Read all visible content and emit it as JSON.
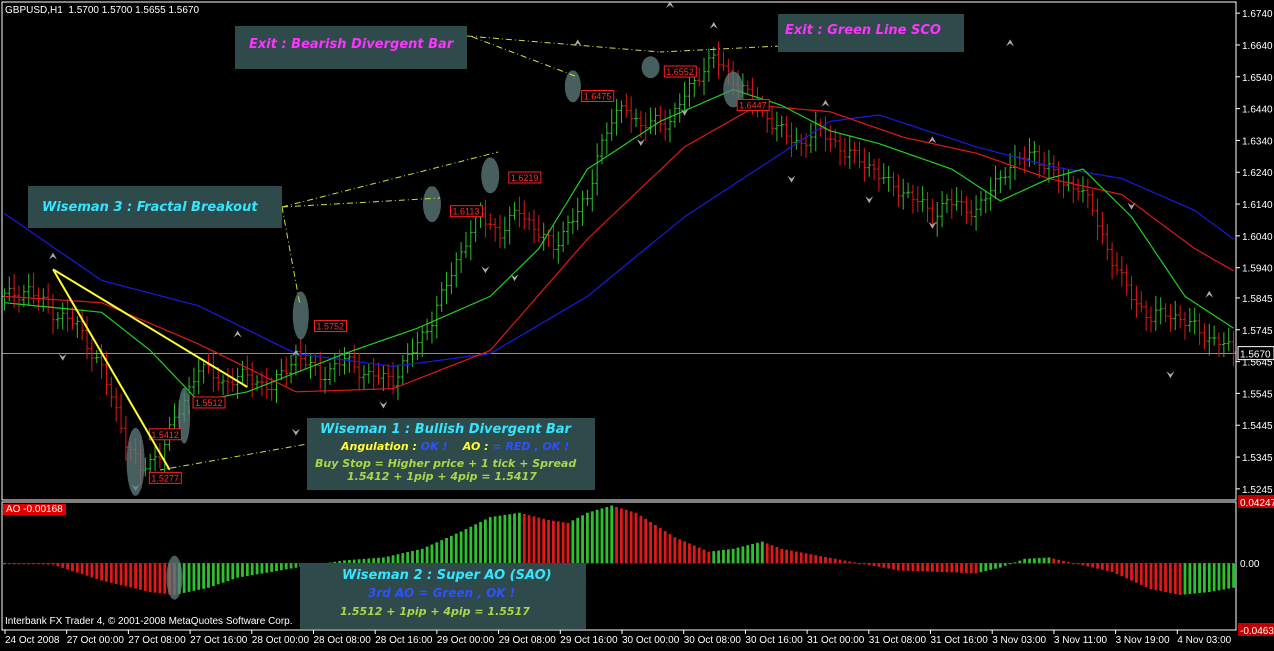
{
  "header": {
    "symbol": "GBPUSD,H1",
    "ohlc": "1.5700 1.5700 1.5655 1.5670"
  },
  "ao_panel": {
    "label": "AO -0.00168",
    "copyright": "Interbank FX Trader 4, © 2001-2008 MetaQuotes Software Corp."
  },
  "notes": {
    "exit1": "Exit : Bearish Divergent Bar",
    "exit2": "Exit : Green Line SCO",
    "wiseman3": "Wiseman 3 : Fractal Breakout",
    "wiseman1": {
      "title": "Wiseman 1 : Bullish Divergent Bar",
      "angulation": "Angulation :",
      "ok1": "OK !",
      "ao": "AO :",
      "red": "= RED , OK !",
      "buystop": "Buy Stop =  Higher price + 1 tick + Spread",
      "calc": "1.5412 + 1pip + 4pip = 1.5417"
    },
    "wiseman2": {
      "title": "Wiseman 2 : Super AO (SAO)",
      "line2": "3rd AO = Green , OK !",
      "line3": "1.5512 + 1pip + 4pip = 1.5517"
    }
  },
  "colors": {
    "bull": "#2ec02e",
    "bear": "#e01818",
    "jaw": "#1a1ae0",
    "teeth": "#e01818",
    "lips": "#20d020",
    "note_bg": "#2e4a4a",
    "yellow": "#ffff33",
    "cyan": "#33e5ff",
    "magenta": "#ff33ff"
  },
  "chart_data": [
    {
      "type": "candlestick",
      "title": "GBPUSD,H1",
      "ylim": [
        1.521,
        1.6775
      ],
      "y_ticks": [
        "1.6740",
        "1.6640",
        "1.6540",
        "1.6440",
        "1.6340",
        "1.6240",
        "1.6140",
        "1.6040",
        "1.5940",
        "1.5845",
        "1.5745",
        "1.5645",
        "1.5545",
        "1.5445",
        "1.5345",
        "1.5245"
      ],
      "current_price": "1.5670",
      "x_ticks": [
        "24 Oct 2008",
        "27 Oct 00:00",
        "27 Oct 08:00",
        "27 Oct 16:00",
        "28 Oct 00:00",
        "28 Oct 08:00",
        "28 Oct 16:00",
        "29 Oct 00:00",
        "29 Oct 08:00",
        "29 Oct 16:00",
        "30 Oct 00:00",
        "30 Oct 08:00",
        "30 Oct 16:00",
        "31 Oct 00:00",
        "31 Oct 08:00",
        "31 Oct 16:00",
        "3 Nov 03:00",
        "3 Nov 11:00",
        "3 Nov 19:00",
        "4 Nov 03:00"
      ],
      "close_path": [
        [
          0,
          1.585
        ],
        [
          5,
          1.587
        ],
        [
          10,
          1.58
        ],
        [
          15,
          1.576
        ],
        [
          20,
          1.562
        ],
        [
          25,
          1.54
        ],
        [
          28,
          1.53
        ],
        [
          32,
          1.536
        ],
        [
          36,
          1.549
        ],
        [
          40,
          1.563
        ],
        [
          45,
          1.558
        ],
        [
          50,
          1.56
        ],
        [
          55,
          1.556
        ],
        [
          60,
          1.567
        ],
        [
          65,
          1.56
        ],
        [
          70,
          1.565
        ],
        [
          75,
          1.56
        ],
        [
          80,
          1.559
        ],
        [
          85,
          1.57
        ],
        [
          88,
          1.578
        ],
        [
          92,
          1.592
        ],
        [
          95,
          1.603
        ],
        [
          98,
          1.61
        ],
        [
          102,
          1.605
        ],
        [
          106,
          1.612
        ],
        [
          110,
          1.605
        ],
        [
          113,
          1.6
        ],
        [
          116,
          1.608
        ],
        [
          120,
          1.615
        ],
        [
          122,
          1.63
        ],
        [
          125,
          1.64
        ],
        [
          128,
          1.645
        ],
        [
          131,
          1.638
        ],
        [
          134,
          1.64
        ],
        [
          137,
          1.64
        ],
        [
          140,
          1.648
        ],
        [
          143,
          1.655
        ],
        [
          146,
          1.66
        ],
        [
          149,
          1.655
        ],
        [
          152,
          1.65
        ],
        [
          155,
          1.645
        ],
        [
          158,
          1.64
        ],
        [
          161,
          1.635
        ],
        [
          164,
          1.633
        ],
        [
          167,
          1.637
        ],
        [
          170,
          1.635
        ],
        [
          173,
          1.63
        ],
        [
          176,
          1.628
        ],
        [
          179,
          1.625
        ],
        [
          182,
          1.62
        ],
        [
          185,
          1.618
        ],
        [
          188,
          1.615
        ],
        [
          191,
          1.61
        ],
        [
          194,
          1.615
        ],
        [
          197,
          1.613
        ],
        [
          200,
          1.612
        ],
        [
          203,
          1.618
        ],
        [
          206,
          1.625
        ],
        [
          209,
          1.628
        ],
        [
          212,
          1.63
        ],
        [
          215,
          1.625
        ],
        [
          218,
          1.62
        ],
        [
          221,
          1.62
        ],
        [
          224,
          1.612
        ],
        [
          227,
          1.6
        ],
        [
          230,
          1.59
        ],
        [
          233,
          1.583
        ],
        [
          236,
          1.578
        ],
        [
          239,
          1.58
        ],
        [
          242,
          1.578
        ],
        [
          245,
          1.575
        ],
        [
          248,
          1.572
        ],
        [
          251,
          1.57
        ],
        [
          253,
          1.567
        ]
      ],
      "alligator": {
        "jaw": [
          [
            0,
            1.611
          ],
          [
            20,
            1.59
          ],
          [
            40,
            1.582
          ],
          [
            60,
            1.567
          ],
          [
            80,
            1.563
          ],
          [
            100,
            1.567
          ],
          [
            120,
            1.585
          ],
          [
            140,
            1.61
          ],
          [
            160,
            1.63
          ],
          [
            170,
            1.64
          ],
          [
            180,
            1.642
          ],
          [
            200,
            1.632
          ],
          [
            215,
            1.626
          ],
          [
            230,
            1.622
          ],
          [
            245,
            1.612
          ],
          [
            253,
            1.603
          ]
        ],
        "teeth": [
          [
            0,
            1.585
          ],
          [
            20,
            1.583
          ],
          [
            40,
            1.57
          ],
          [
            60,
            1.555
          ],
          [
            80,
            1.556
          ],
          [
            100,
            1.568
          ],
          [
            120,
            1.603
          ],
          [
            140,
            1.632
          ],
          [
            155,
            1.645
          ],
          [
            170,
            1.643
          ],
          [
            185,
            1.635
          ],
          [
            200,
            1.63
          ],
          [
            215,
            1.622
          ],
          [
            230,
            1.617
          ],
          [
            245,
            1.6
          ],
          [
            253,
            1.593
          ]
        ],
        "lips": [
          [
            0,
            1.583
          ],
          [
            20,
            1.58
          ],
          [
            30,
            1.568
          ],
          [
            40,
            1.552
          ],
          [
            50,
            1.555
          ],
          [
            70,
            1.567
          ],
          [
            85,
            1.575
          ],
          [
            100,
            1.585
          ],
          [
            110,
            1.6
          ],
          [
            120,
            1.625
          ],
          [
            135,
            1.64
          ],
          [
            150,
            1.65
          ],
          [
            160,
            1.645
          ],
          [
            170,
            1.637
          ],
          [
            180,
            1.633
          ],
          [
            195,
            1.625
          ],
          [
            205,
            1.615
          ],
          [
            215,
            1.622
          ],
          [
            222,
            1.625
          ],
          [
            232,
            1.61
          ],
          [
            243,
            1.585
          ],
          [
            253,
            1.575
          ]
        ]
      },
      "price_labels": [
        "1.5412",
        "1.5512",
        "1.5277",
        "1.5752",
        "1.6113",
        "1.6219",
        "1.6475",
        "1.6552",
        "1.6447"
      ]
    },
    {
      "type": "bar",
      "title": "AO -0.00168",
      "ylim": [
        -0.04631,
        0.04247
      ],
      "y_ticks": [
        "0.04247",
        "0.00",
        "-0.04631"
      ],
      "values_profile": [
        [
          0,
          0
        ],
        [
          10,
          -0.001
        ],
        [
          20,
          -0.012
        ],
        [
          30,
          -0.02
        ],
        [
          35,
          -0.022
        ],
        [
          42,
          -0.017
        ],
        [
          48,
          -0.01
        ],
        [
          55,
          -0.006
        ],
        [
          62,
          -0.002
        ],
        [
          70,
          0.002
        ],
        [
          78,
          0.004
        ],
        [
          86,
          0.01
        ],
        [
          94,
          0.022
        ],
        [
          100,
          0.032
        ],
        [
          106,
          0.035
        ],
        [
          112,
          0.03
        ],
        [
          116,
          0.028
        ],
        [
          120,
          0.035
        ],
        [
          125,
          0.04
        ],
        [
          130,
          0.035
        ],
        [
          138,
          0.018
        ],
        [
          145,
          0.008
        ],
        [
          150,
          0.01
        ],
        [
          156,
          0.015
        ],
        [
          160,
          0.01
        ],
        [
          168,
          0.005
        ],
        [
          176,
          0
        ],
        [
          184,
          -0.005
        ],
        [
          192,
          -0.006
        ],
        [
          200,
          -0.007
        ],
        [
          205,
          -0.003
        ],
        [
          210,
          0.003
        ],
        [
          215,
          0.004
        ],
        [
          220,
          0
        ],
        [
          228,
          -0.006
        ],
        [
          236,
          -0.018
        ],
        [
          242,
          -0.022
        ],
        [
          248,
          -0.02
        ],
        [
          253,
          -0.017
        ]
      ]
    }
  ]
}
